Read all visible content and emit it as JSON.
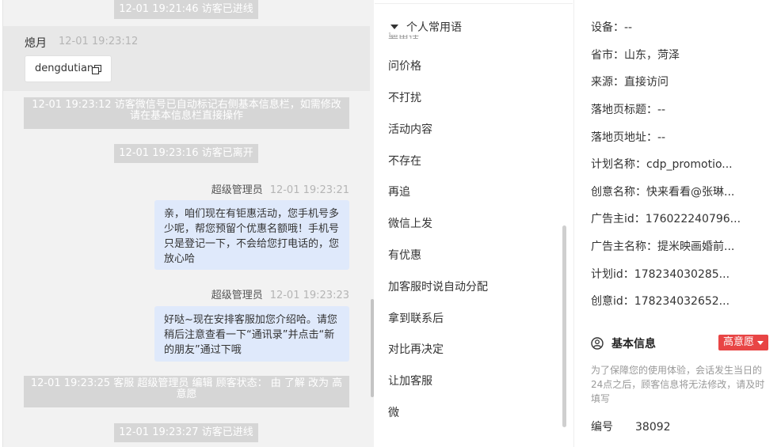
{
  "chat": {
    "sys_top": "12-01 19:21:46 访客已进线",
    "visitor": {
      "name": "熄月",
      "time": "12-01 19:23:12",
      "message": "dengdutian"
    },
    "sys_wechat": "12-01 19:23:12 访客微信号已自动标记右侧基本信息栏，如需修改请在基本信息栏直接操作",
    "sys_left": "12-01 19:23:16 访客已离开",
    "agent_msg1": {
      "name": "超级管理员",
      "time": "12-01 19:23:21",
      "text": "亲，咱们现在有钜惠活动，您手机号多少呢，帮您预留个优惠名额哦！手机号只是登记一下，不会给您打电话的，您放心哈"
    },
    "agent_msg2": {
      "name": "超级管理员",
      "time": "12-01 19:23:23",
      "text": "好哒~现在安排客服加您介绍哈。请您稍后注意查看一下“通讯录”并点击“新的朋友”通过下哦"
    },
    "sys_status": "12-01 19:23:25 客服 超级管理员 编辑 顾客状态： 由 了解 改为 高意愿",
    "sys_bottom": "12-01 19:23:27 访客已进线"
  },
  "phrases": {
    "header": "个人常用语",
    "partial_item": "要电话",
    "items": [
      "问价格",
      "不打扰",
      "活动内容",
      "不存在",
      "再追",
      "微信上发",
      "有优惠",
      "加客服时说自动分配",
      "拿到联系后",
      "对比再决定",
      "让加客服",
      "微"
    ]
  },
  "info": {
    "device_label": "设备：",
    "device_value": "--",
    "city_label": "省市：",
    "city_value": "山东，菏泽",
    "source_label": "来源：",
    "source_value": "直接访问",
    "landing_title_label": "落地页标题：",
    "landing_title_value": "--",
    "landing_url_label": "落地页地址：",
    "landing_url_value": "--",
    "plan_name_label": "计划名称：",
    "plan_name_value": "cdp_promotio...",
    "creative_name_label": "创意名称：",
    "creative_name_value": "快来看看@张琳...",
    "advertiser_id_label": "广告主id：",
    "advertiser_id_value": "176022240796...",
    "advertiser_name_label": "广告主名称：",
    "advertiser_name_value": "提米映画婚前...",
    "plan_id_label": "计划id：",
    "plan_id_value": "178234030285...",
    "creative_id_label": "创意id：",
    "creative_id_value": "178234032652...",
    "basic_title": "基本信息",
    "intent_tag": "高意愿",
    "note": "为了保障您的使用体验，会话发生当日的24点之后，顾客信息将无法修改，请及时填写",
    "number_label": "编号",
    "number_value": "38092"
  },
  "colors": {
    "agent_bubble": "#dfe9fb",
    "system_msg": "#d6d6d6",
    "intent_tag": "#e84545"
  }
}
